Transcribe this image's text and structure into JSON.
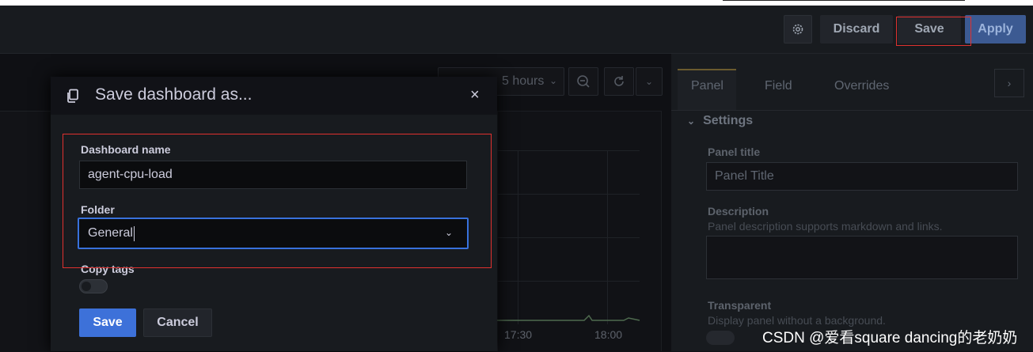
{
  "toolbar": {
    "settings_icon": "gear-icon",
    "discard_label": "Discard",
    "save_label": "Save",
    "apply_label": "Apply"
  },
  "dashboard": {
    "time_range": "5 hours",
    "x_ticks": [
      "17:30",
      "18:00"
    ]
  },
  "options_pane": {
    "tabs": [
      "Panel",
      "Field",
      "Overrides"
    ],
    "active_tab": "Panel",
    "section": "Settings",
    "panel_title_label": "Panel title",
    "panel_title_value": "Panel Title",
    "description_label": "Description",
    "description_hint": "Panel description supports markdown and links.",
    "transparent_label": "Transparent",
    "transparent_hint": "Display panel without a background."
  },
  "modal": {
    "icon": "copy-icon",
    "title": "Save dashboard as...",
    "close_glyph": "×",
    "dashboard_name_label": "Dashboard name",
    "dashboard_name_value": "agent-cpu-load",
    "folder_label": "Folder",
    "folder_value": "General",
    "copy_tags_label": "Copy tags",
    "copy_tags_on": false,
    "save_label": "Save",
    "cancel_label": "Cancel"
  },
  "watermark": "CSDN @爱看square dancing的老奶奶",
  "colors": {
    "primary": "#3d71d9",
    "focus_border": "#3871dc",
    "annotation_red": "#e0312f"
  }
}
